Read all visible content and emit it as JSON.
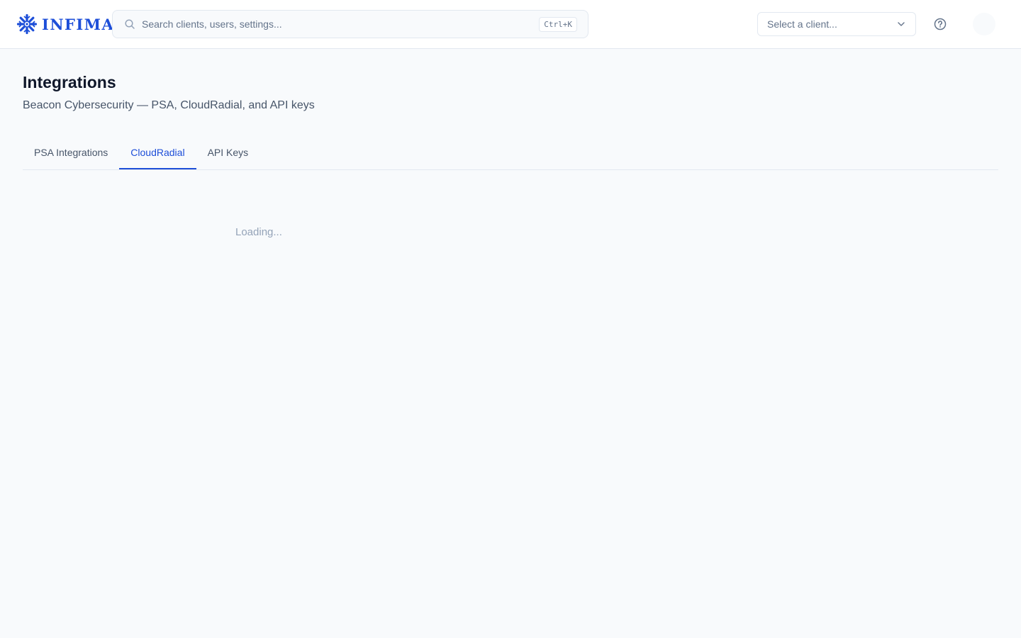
{
  "brand": {
    "name": "INFIMA",
    "accent": "#1d4ed8"
  },
  "search": {
    "placeholder": "Search clients, users, settings...",
    "value": "",
    "shortcut": "Ctrl+K",
    "icon": "search-icon"
  },
  "client_select": {
    "placeholder": "Select a client...",
    "icon": "chevron-down-icon"
  },
  "help": {
    "icon": "help-circle-icon"
  },
  "page": {
    "title": "Integrations",
    "subtitle": "Beacon Cybersecurity — PSA, CloudRadial, and API keys"
  },
  "tabs": [
    {
      "label": "PSA Integrations",
      "active": false
    },
    {
      "label": "CloudRadial",
      "active": true
    },
    {
      "label": "API Keys",
      "active": false
    }
  ],
  "content": {
    "loading_text": "Loading..."
  }
}
